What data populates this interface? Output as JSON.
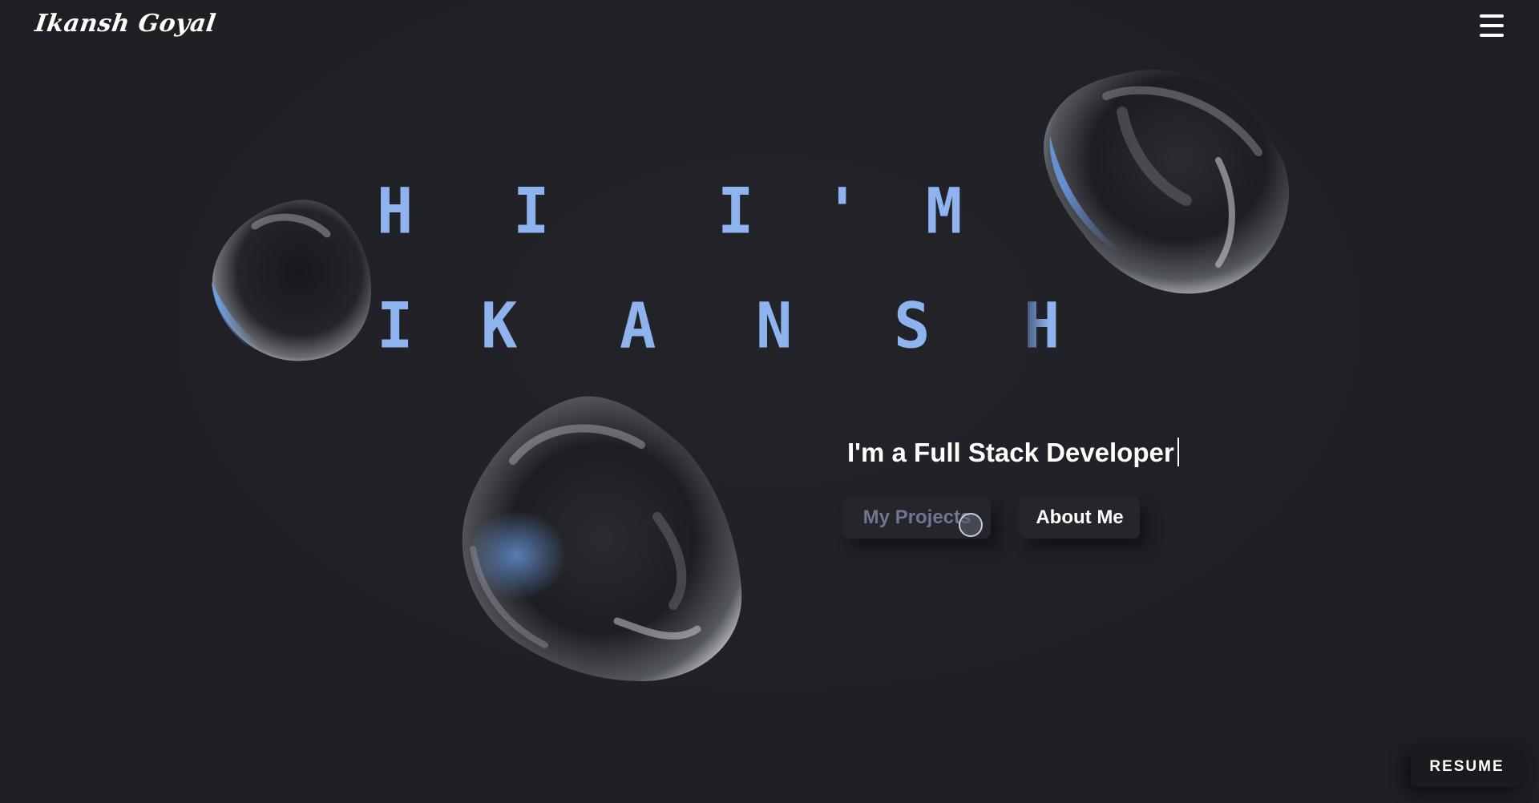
{
  "header": {
    "logo_text": "Ikansh Goyal",
    "menu_icon": "hamburger-menu-icon"
  },
  "hero": {
    "line1": [
      "H",
      "I",
      "I",
      "'",
      "M"
    ],
    "line2": [
      "I",
      "K",
      "A",
      "N",
      "S",
      "H"
    ],
    "tagline": "I'm a Full Stack Developer"
  },
  "actions": {
    "projects_label": "My Projects",
    "about_label": "About Me",
    "resume_label": "RESUME"
  },
  "colors": {
    "background": "#1f2025",
    "hero_text": "#8fb3ee",
    "button_bg": "#25262c",
    "projects_text_hover": "#6e7691"
  }
}
